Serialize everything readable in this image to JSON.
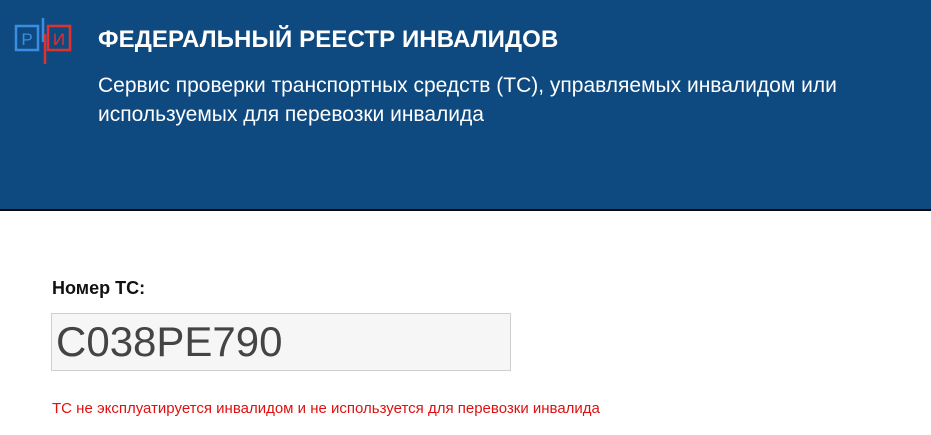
{
  "header": {
    "logo_text": "РИ",
    "title": "ФЕДЕРАЛЬНЫЙ РЕЕСТР ИНВАЛИДОВ",
    "subtitle": "Сервис проверки транспортных средств (ТС), управляемых инвалидом или используемых для перевозки инвалида"
  },
  "form": {
    "vehicle_number_label": "Номер ТС:",
    "vehicle_number_value": "С038РЕ790"
  },
  "result": {
    "message": "ТС не эксплуатируется инвалидом и не используется для перевозки инвалида"
  },
  "colors": {
    "header_bg": "#0e4a80",
    "logo_blue": "#3a8de0",
    "logo_red": "#e03030",
    "error_text": "#e01010"
  }
}
